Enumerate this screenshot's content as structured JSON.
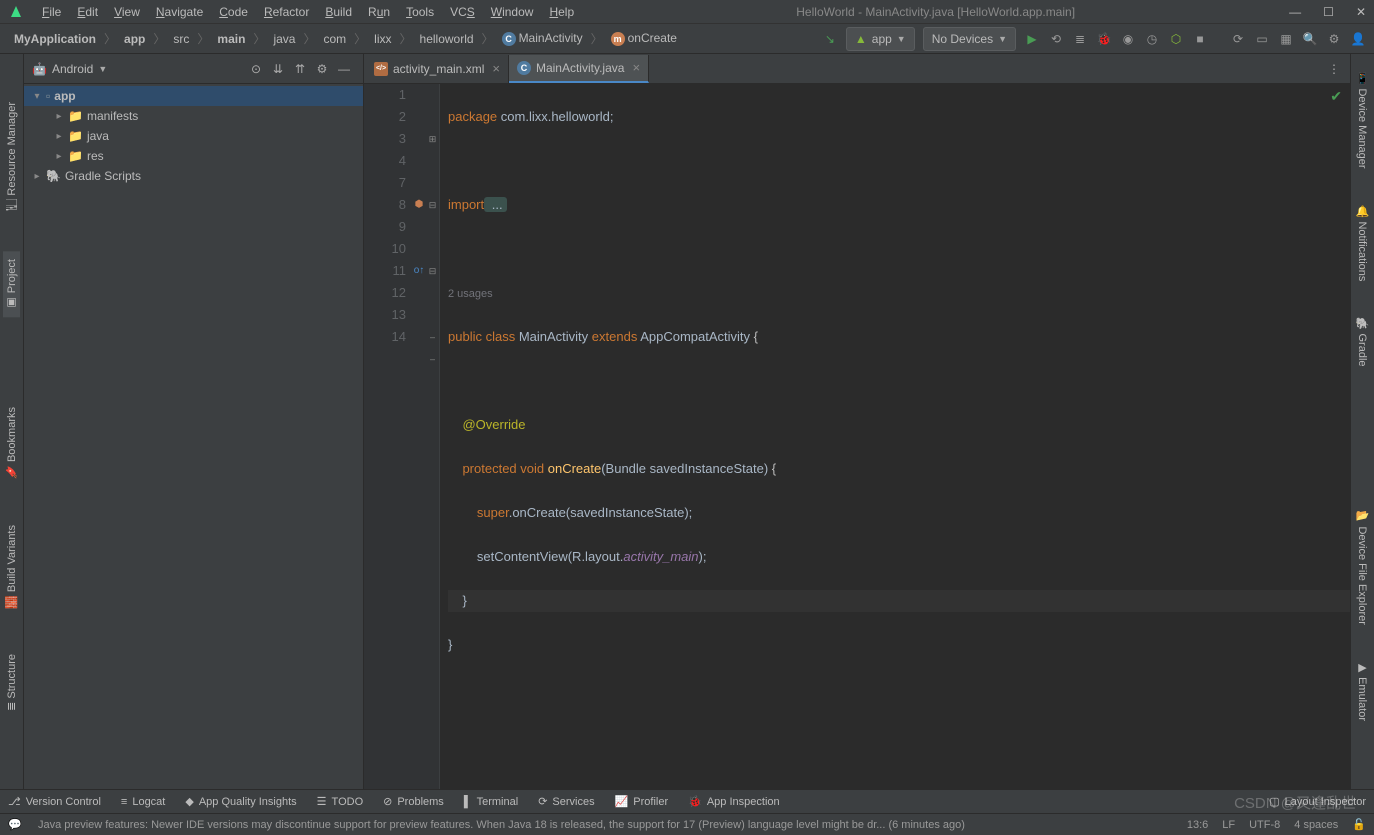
{
  "window_title": "HelloWorld - MainActivity.java [HelloWorld.app.main]",
  "menu": [
    "File",
    "Edit",
    "View",
    "Navigate",
    "Code",
    "Refactor",
    "Build",
    "Run",
    "Tools",
    "VCS",
    "Window",
    "Help"
  ],
  "breadcrumbs": [
    "MyApplication",
    "app",
    "src",
    "main",
    "java",
    "com",
    "lixx",
    "helloworld",
    "MainActivity",
    "onCreate"
  ],
  "run_config": {
    "app": "app",
    "device": "No Devices"
  },
  "project_panel": {
    "view": "Android",
    "tree": {
      "app": "app",
      "manifests": "manifests",
      "java": "java",
      "res": "res",
      "gradle": "Gradle Scripts"
    }
  },
  "tabs": [
    {
      "name": "activity_main.xml",
      "type": "xml",
      "active": false
    },
    {
      "name": "MainActivity.java",
      "type": "java",
      "active": true
    }
  ],
  "line_numbers": [
    "1",
    "2",
    "3",
    "4",
    "",
    "7",
    "8",
    "9",
    "10",
    "11",
    "12",
    "13",
    "14"
  ],
  "usage_hint": "2 usages",
  "code": {
    "l1": {
      "package": "package",
      "rest": " com.lixx.helloworld;"
    },
    "l3": {
      "import": "import",
      "dots": " ..."
    },
    "l7": {
      "public": "public",
      "class": " class",
      "name": " MainActivity",
      "extends": " extends",
      "parent": " AppCompatActivity",
      "brace": " {"
    },
    "l9": {
      "override": "@Override"
    },
    "l10": {
      "protected": "protected",
      "void": " void",
      "fn": " onCreate",
      "params": "(Bundle savedInstanceState)",
      "brace": " {"
    },
    "l11": {
      "super": "super",
      "call": ".onCreate(savedInstanceState);"
    },
    "l12": {
      "call": "setContentView(R.layout.",
      "itl": "activity_main",
      "end": ");"
    },
    "l13": "}",
    "l14": "}"
  },
  "left_tabs": [
    "Resource Manager",
    "Project",
    "Bookmarks",
    "Build Variants",
    "Structure"
  ],
  "right_tabs": [
    "Device Manager",
    "Notifications",
    "Gradle",
    "Device File Explorer",
    "Emulator"
  ],
  "bottom_tools": [
    "Version Control",
    "Logcat",
    "App Quality Insights",
    "TODO",
    "Problems",
    "Terminal",
    "Services",
    "Profiler",
    "App Inspection"
  ],
  "bottom_right_tool": "Layout Inspector",
  "status": {
    "message": "Java preview features: Newer IDE versions may discontinue support for preview features. When Java 18 is released, the support for 17 (Preview) language level might be dr... (6 minutes ago)",
    "position": "13:6",
    "line_sep": "LF",
    "encoding": "UTF-8",
    "indent": "4 spaces"
  },
  "watermark": "CSDN @又逢乱世"
}
